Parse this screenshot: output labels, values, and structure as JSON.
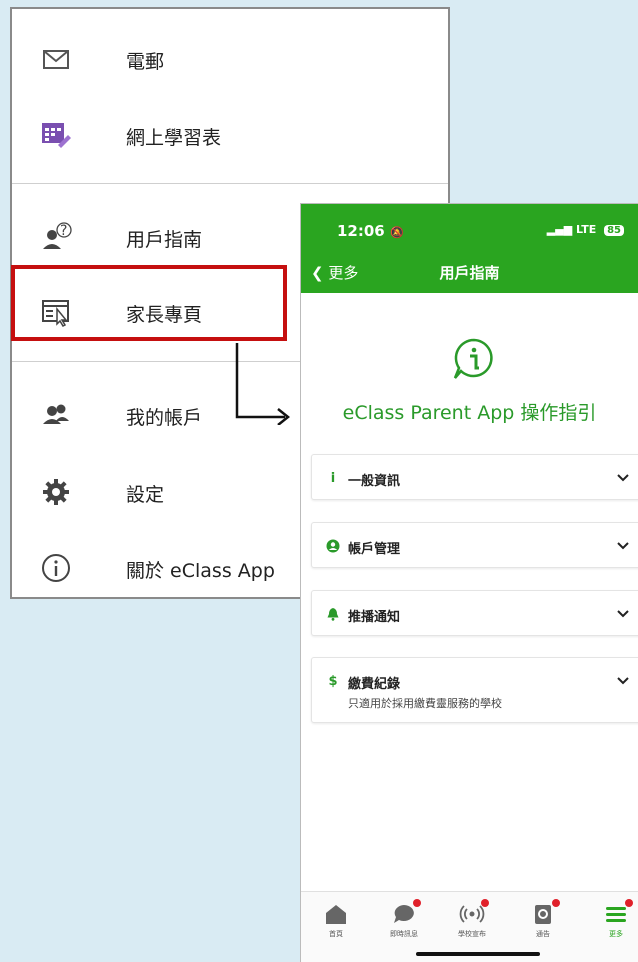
{
  "menu": {
    "items": [
      {
        "label": "電郵",
        "icon": "mail-icon"
      },
      {
        "label": "網上學習表",
        "icon": "timetable-icon"
      },
      {
        "label": "用戶指南",
        "icon": "user-guide-icon"
      },
      {
        "label": "家長專頁",
        "icon": "parent-page-icon"
      },
      {
        "label": "我的帳戶",
        "icon": "account-icon"
      },
      {
        "label": "設定",
        "icon": "gear-icon"
      },
      {
        "label": "關於 eClass App",
        "icon": "info-icon"
      }
    ]
  },
  "phone": {
    "status": {
      "time": "12:06",
      "network": "LTE",
      "battery": "85"
    },
    "nav": {
      "back_label": "更多",
      "title": "用戶指南"
    },
    "guide_title": "eClass Parent App 操作指引",
    "sections": [
      {
        "icon": "info-icon",
        "label": "一般資訊",
        "subtitle": ""
      },
      {
        "icon": "user-circle-icon",
        "label": "帳戶管理",
        "subtitle": ""
      },
      {
        "icon": "bell-icon",
        "label": "推播通知",
        "subtitle": ""
      },
      {
        "icon": "dollar-icon",
        "label": "繳費紀錄",
        "subtitle": "只適用於採用繳費靈服務的學校"
      }
    ],
    "tabs": [
      {
        "label": "首頁",
        "icon": "home-icon",
        "badge": false
      },
      {
        "label": "即時訊息",
        "icon": "chat-icon",
        "badge": true
      },
      {
        "label": "學校宣布",
        "icon": "broadcast-icon",
        "badge": true
      },
      {
        "label": "通告",
        "icon": "notice-icon",
        "badge": true
      },
      {
        "label": "更多",
        "icon": "menu-icon",
        "badge": false,
        "active": true
      }
    ],
    "colors": {
      "primary": "#2aa520",
      "accent_text": "#2a9a2a",
      "badge": "#e0202a"
    }
  },
  "highlight_color": "#c50f0f"
}
